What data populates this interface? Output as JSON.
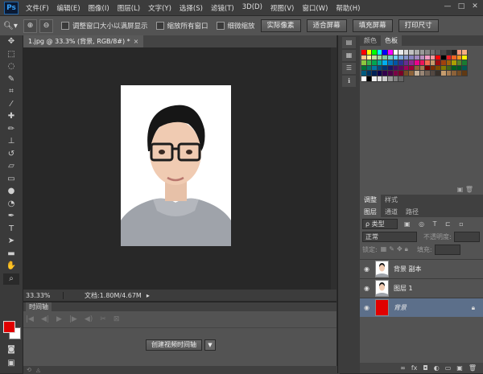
{
  "app": {
    "logo": "Ps"
  },
  "menu": [
    "文件(F)",
    "编辑(E)",
    "图像(I)",
    "图层(L)",
    "文字(Y)",
    "选择(S)",
    "滤镜(T)",
    "3D(D)",
    "视图(V)",
    "窗口(W)",
    "帮助(H)"
  ],
  "window_controls": {
    "minimize": "—",
    "maximize": "□",
    "close": "✕"
  },
  "options_bar": {
    "tool_icon": "zoom-icon",
    "checkbox_resize": "调整窗口大小以满屏显示",
    "checkbox_all_windows": "缩放所有窗口",
    "checkbox_scrubby": "细微缩放",
    "btn_actual": "实际像素",
    "btn_fit": "适合屏幕",
    "btn_fill": "填充屏幕",
    "btn_print": "打印尺寸"
  },
  "document": {
    "tab_title": "1.jpg @ 33.3% (背景, RGB/8#) *",
    "zoom": "33.33%",
    "doc_info": "文档:1.80M/4.67M"
  },
  "timeline": {
    "tab": "时间轴",
    "create_button": "创建视频时间轴"
  },
  "swatches_panel": {
    "tabs": [
      "颜色",
      "色板"
    ],
    "colors": [
      "#ff0000",
      "#ffff00",
      "#00ff00",
      "#00ffff",
      "#0000ff",
      "#ff00ff",
      "#ffffff",
      "#ebebeb",
      "#d6d6d6",
      "#c2c2c2",
      "#adadad",
      "#999999",
      "#858585",
      "#707070",
      "#5c5c5c",
      "#474747",
      "#333333",
      "#1f1f1f",
      "#f7977a",
      "#f9ad81",
      "#fdc68a",
      "#fff79a",
      "#c4df9b",
      "#a2d39c",
      "#82ca9d",
      "#7bcdc8",
      "#6ecff6",
      "#7ea7d8",
      "#8493ca",
      "#8882be",
      "#a187be",
      "#bc8dbf",
      "#f49ac2",
      "#f6989d",
      "#ff0000",
      "#000000",
      "#ed1c24",
      "#f26522",
      "#f7941d",
      "#fff200",
      "#8dc73f",
      "#39b54a",
      "#00a651",
      "#00a99d",
      "#00aeef",
      "#0072bc",
      "#0054a6",
      "#2e3192",
      "#662d91",
      "#92278f",
      "#ec008c",
      "#ed145b",
      "#f26c4f",
      "#c69c6e",
      "#9e0b0f",
      "#a0410d",
      "#a36209",
      "#aba000",
      "#598527",
      "#197b30",
      "#007236",
      "#00746b",
      "#0076a3",
      "#004b80",
      "#003471",
      "#1b1464",
      "#440e62",
      "#630460",
      "#9e005d",
      "#9e0039",
      "#8c6239",
      "#a67c52",
      "#790000",
      "#7b2e00",
      "#7d4900",
      "#827b00",
      "#406618",
      "#005e20",
      "#005826",
      "#005952",
      "#005b7f",
      "#003663",
      "#002157",
      "#0d004c",
      "#32004b",
      "#4b0049",
      "#7b0046",
      "#7a0026",
      "#754c24",
      "#8c6239",
      "#c7b299",
      "#998675",
      "#736357",
      "#534741",
      "#37302a",
      "#c69c6d",
      "#a67c52",
      "#8c6239",
      "#754c24",
      "#603913",
      "#ffffff",
      "#000000",
      "#f0f0f0",
      "#e0e0e0",
      "#cccccc",
      "#999999",
      "#7f7f7f",
      "#666666"
    ]
  },
  "adjust_tabs": [
    "调整",
    "样式"
  ],
  "layers_panel": {
    "tabs": [
      "图层",
      "通道",
      "路径"
    ],
    "filter_label": "ρ 类型",
    "blend_mode": "正常",
    "opacity_label": "不透明度:",
    "lock_label": "锁定:",
    "fill_label": "填充:",
    "layers": [
      {
        "name": "背景 副本",
        "selected": false
      },
      {
        "name": "图层 1",
        "selected": false
      },
      {
        "name": "背景",
        "selected": true
      }
    ]
  }
}
